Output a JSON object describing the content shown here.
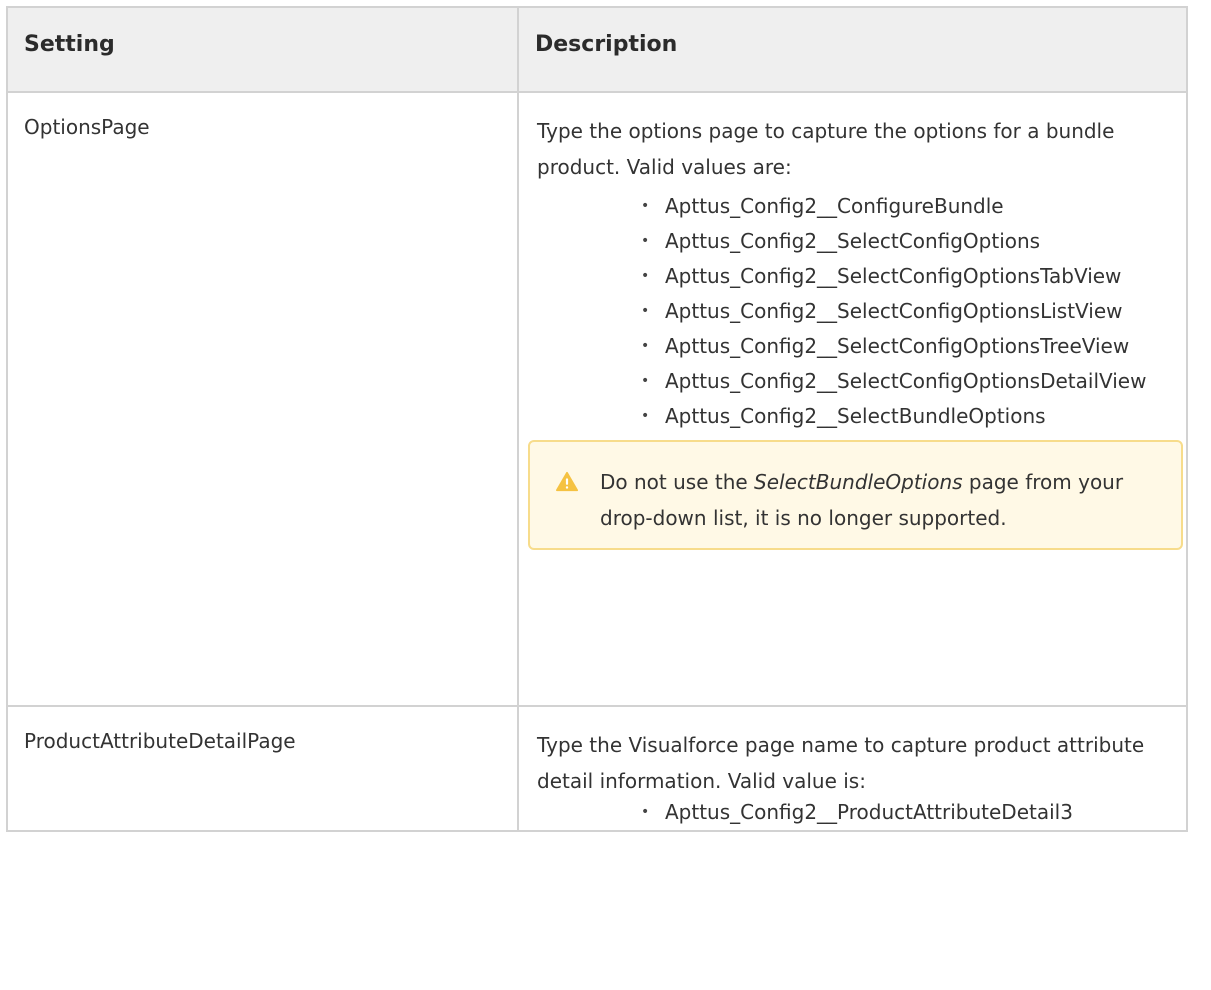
{
  "table": {
    "headers": [
      "Setting",
      "Description"
    ],
    "rows": [
      {
        "setting": "OptionsPage",
        "description": "Type the options page to capture the options for a bundle product. Valid values are:",
        "values": [
          "Apttus_Config2__ConfigureBundle",
          "Apttus_Config2__SelectConfigOptions",
          "Apttus_Config2__SelectConfigOptionsTabView",
          "Apttus_Config2__SelectConfigOptionsListView",
          "Apttus_Config2__SelectConfigOptionsTreeView",
          "Apttus_Config2__SelectConfigOptionsDetailView",
          "Apttus_Config2__SelectBundleOptions"
        ],
        "warning": {
          "icon": "warning-triangle-icon",
          "before": "Do not use the ",
          "emphasis": "SelectBundleOptions",
          "after": " page from your drop-down list, it is no longer supported."
        }
      },
      {
        "setting": "ProductAttributeDetailPage",
        "description": "Type the Visualforce page name to capture product attribute detail information. Valid value is:",
        "values": [
          "Apttus_Config2__ProductAttributeDetail3"
        ]
      }
    ]
  },
  "colors": {
    "header_bg": "#efefef",
    "border": "#d2d2d2",
    "warning_bg": "#fff9e6",
    "warning_border": "#f7dc8b",
    "warning_icon": "#f5c242"
  }
}
